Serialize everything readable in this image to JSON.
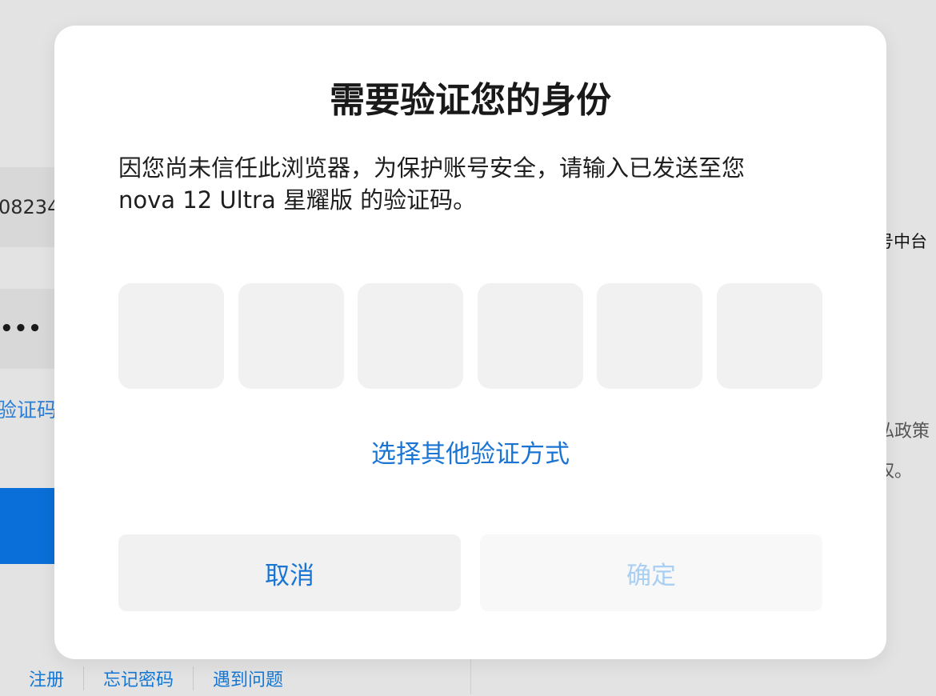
{
  "background": {
    "account_fragment": "08234",
    "password_mask": "•••",
    "sms_login_fragment": "验证码",
    "right_fragments": [
      "号中台",
      "私政策",
      "权。"
    ],
    "footer": {
      "register": "注册",
      "forgot_password": "忘记密码",
      "problem": "遇到问题"
    }
  },
  "dialog": {
    "title": "需要验证您的身份",
    "message_line1": "因您尚未信任此浏览器，为保护账号安全，请输入已发送至您",
    "message_line2": "nova 12 Ultra 星耀版 的验证码。",
    "code_length": 6,
    "other_method": "选择其他验证方式",
    "cancel_label": "取消",
    "confirm_label": "确定",
    "colors": {
      "accent": "#1a74d4",
      "disabled_text": "#a9cff2",
      "input_bg": "#f1f1f1"
    }
  }
}
